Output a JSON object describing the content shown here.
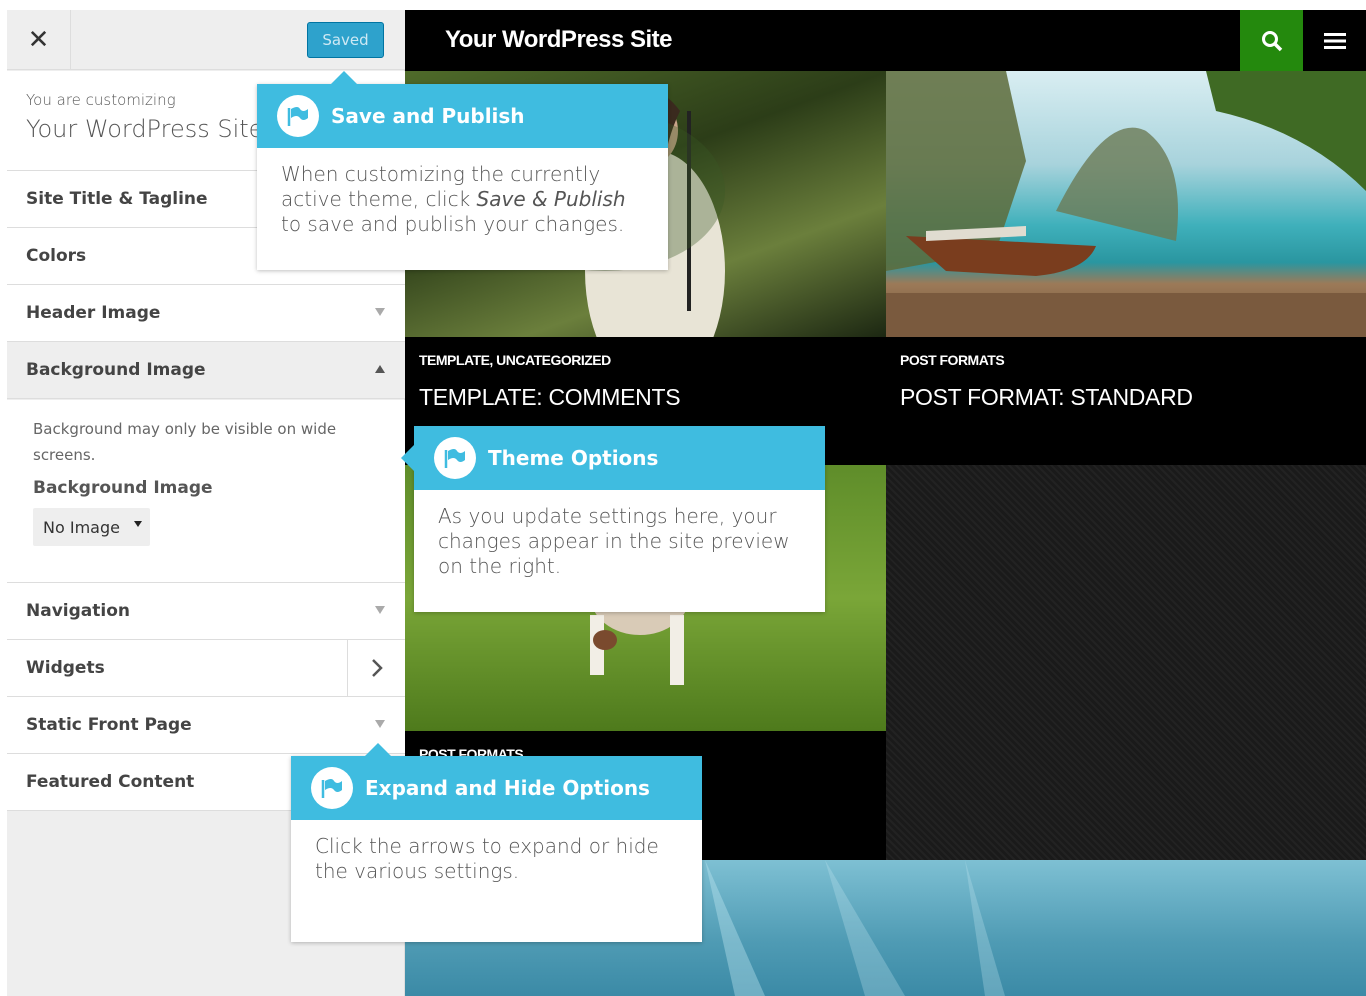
{
  "sidebar": {
    "close_icon": "close-icon",
    "saved_label": "Saved",
    "customizing_label": "You are customizing",
    "site_name": "Your WordPress Site",
    "sections": [
      {
        "label": "Site Title & Tagline"
      },
      {
        "label": "Colors"
      },
      {
        "label": "Header Image"
      },
      {
        "label": "Background Image"
      },
      {
        "label": "Navigation"
      },
      {
        "label": "Widgets"
      },
      {
        "label": "Static Front Page"
      },
      {
        "label": "Featured Content"
      }
    ],
    "background_panel": {
      "description": "Background may only be visible on wide screens.",
      "field_label": "Background Image",
      "select_value": "No Image"
    }
  },
  "preview": {
    "site_title": "Your WordPress Site",
    "search_icon": "search-icon",
    "menu_icon": "hamburger-menu-icon",
    "accent_color": "#24890d",
    "posts": [
      {
        "category": "TEMPLATE, UNCATEGORIZED",
        "title": "TEMPLATE: COMMENTS"
      },
      {
        "category": "POST FORMATS",
        "title": "POST FORMAT: STANDARD"
      },
      {
        "category": "POST FORMATS"
      }
    ]
  },
  "tooltips": {
    "accent_color": "#3fbce0",
    "save": {
      "title": "Save and Publish",
      "body_before": "When customizing the currently active theme, click ",
      "body_em": "Save & Publish",
      "body_after": " to save and publish your changes."
    },
    "theme": {
      "title": "Theme Options",
      "body": "As you update settings here, your changes appear in the site preview on the right."
    },
    "expand": {
      "title": "Expand and Hide Options",
      "body": "Click the arrows to expand or hide the various settings."
    }
  }
}
